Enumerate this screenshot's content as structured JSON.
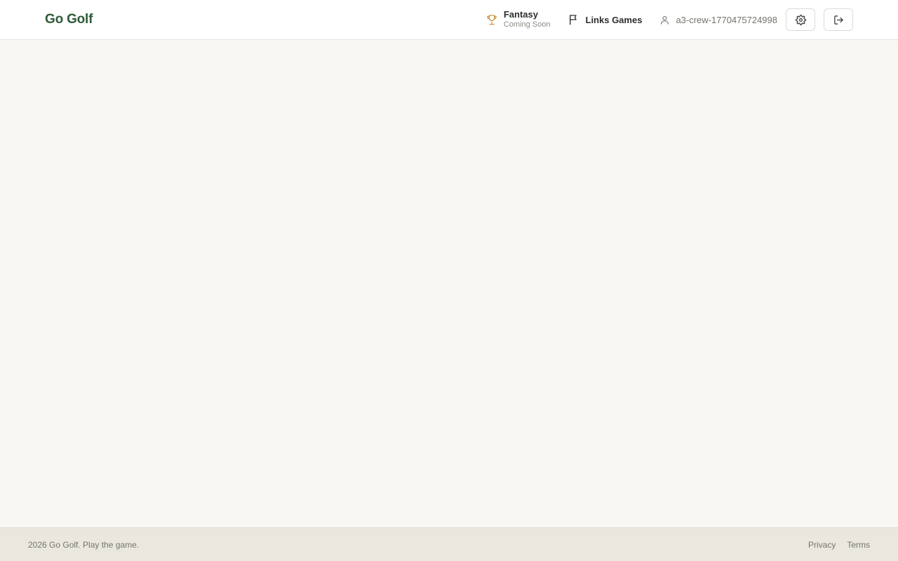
{
  "header": {
    "brand": "Go Golf",
    "nav": {
      "fantasy": {
        "label": "Fantasy",
        "sublabel": "Coming Soon",
        "icon": "trophy-icon"
      },
      "links_games": {
        "label": "Links Games",
        "icon": "flag-icon"
      },
      "user": {
        "label": "a3-crew-1770475724998",
        "icon": "user-icon"
      }
    },
    "buttons": {
      "settings": {
        "icon": "gear-icon"
      },
      "logout": {
        "icon": "logout-icon"
      }
    }
  },
  "footer": {
    "copyright": "2026 Go Golf. Play the game.",
    "links": [
      "Privacy",
      "Terms"
    ]
  },
  "colors": {
    "brand": "#2f5a3a",
    "trophy": "#c9953f",
    "background": "#f8f7f3",
    "footer_bg": "#eae7df"
  }
}
